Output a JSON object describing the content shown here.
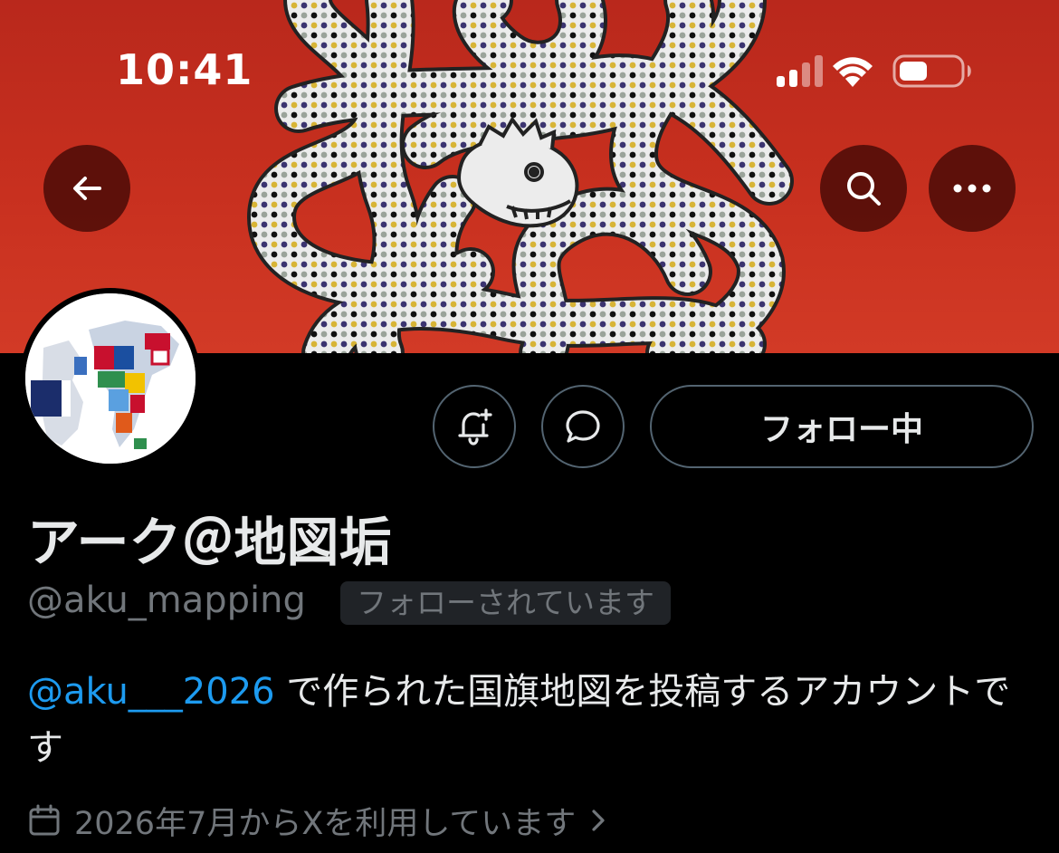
{
  "status_bar": {
    "time": "10:41"
  },
  "header": {
    "back_icon": "arrow-left-icon",
    "search_icon": "search-icon",
    "more_icon": "more-horizontal-icon"
  },
  "banner": {
    "colors": {
      "background": "#c8301f",
      "serpent": "#ececec"
    }
  },
  "profile": {
    "display_name": "アーク＠地図垢",
    "handle": "@aku_mapping",
    "follows_you": "フォローされています",
    "follow_button": "フォロー中",
    "bio_mention": "@aku___2026",
    "bio_text": " で作られた国旗地図を投稿するアカウントです",
    "joined": "2026年7月からXを利用しています"
  },
  "colors": {
    "link": "#1d9bf0",
    "muted": "#71767b",
    "text": "#e7e9ea",
    "border": "#536471"
  }
}
